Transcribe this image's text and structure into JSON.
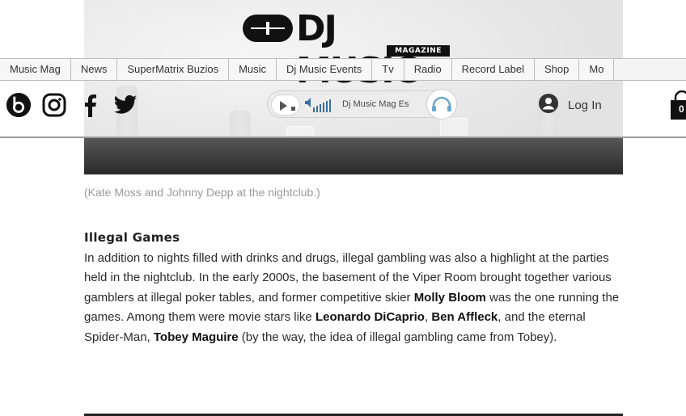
{
  "logo": {
    "wordmark": "DJ MUSIC",
    "sub": "MAGAZINE"
  },
  "nav": {
    "tabs": [
      "Music Mag",
      "News",
      "SuperMatrix Buzios",
      "Music",
      "Dj Music Events",
      "Tv",
      "Radio",
      "Record Label",
      "Shop",
      "Mo"
    ]
  },
  "social": [
    "beatport-icon",
    "instagram-icon",
    "facebook-icon",
    "twitter-icon"
  ],
  "player": {
    "station": "Dj Music Mag Es"
  },
  "login": {
    "label": "Log In"
  },
  "cart": {
    "count": "0"
  },
  "article": {
    "caption": "(Kate Moss and Johnny Depp at the nightclub.)",
    "heading": "Illegal Games",
    "p1_a": "In addition to nights filled with drinks and drugs, illegal gambling was also a highlight at the parties held in the nightclub. In the early 2000s, the basement of the Viper Room brought together various gamblers at illegal poker tables, and former competitive skier ",
    "molly": "Molly Bloom",
    "p1_b": " was the one running the games. Among them were movie stars like ",
    "leo": "Leonardo DiCaprio",
    "comma": ", ",
    "ben": "Ben Affleck",
    "p1_c": ", and the eternal Spider-Man, ",
    "tobey": "Tobey Maguire",
    "p1_d": " (by the way, the idea of illegal gambling came from Tobey)."
  },
  "colors": {
    "text": "#2b2b2b",
    "caption": "#9a9a9a",
    "border": "#bdbdbd"
  }
}
